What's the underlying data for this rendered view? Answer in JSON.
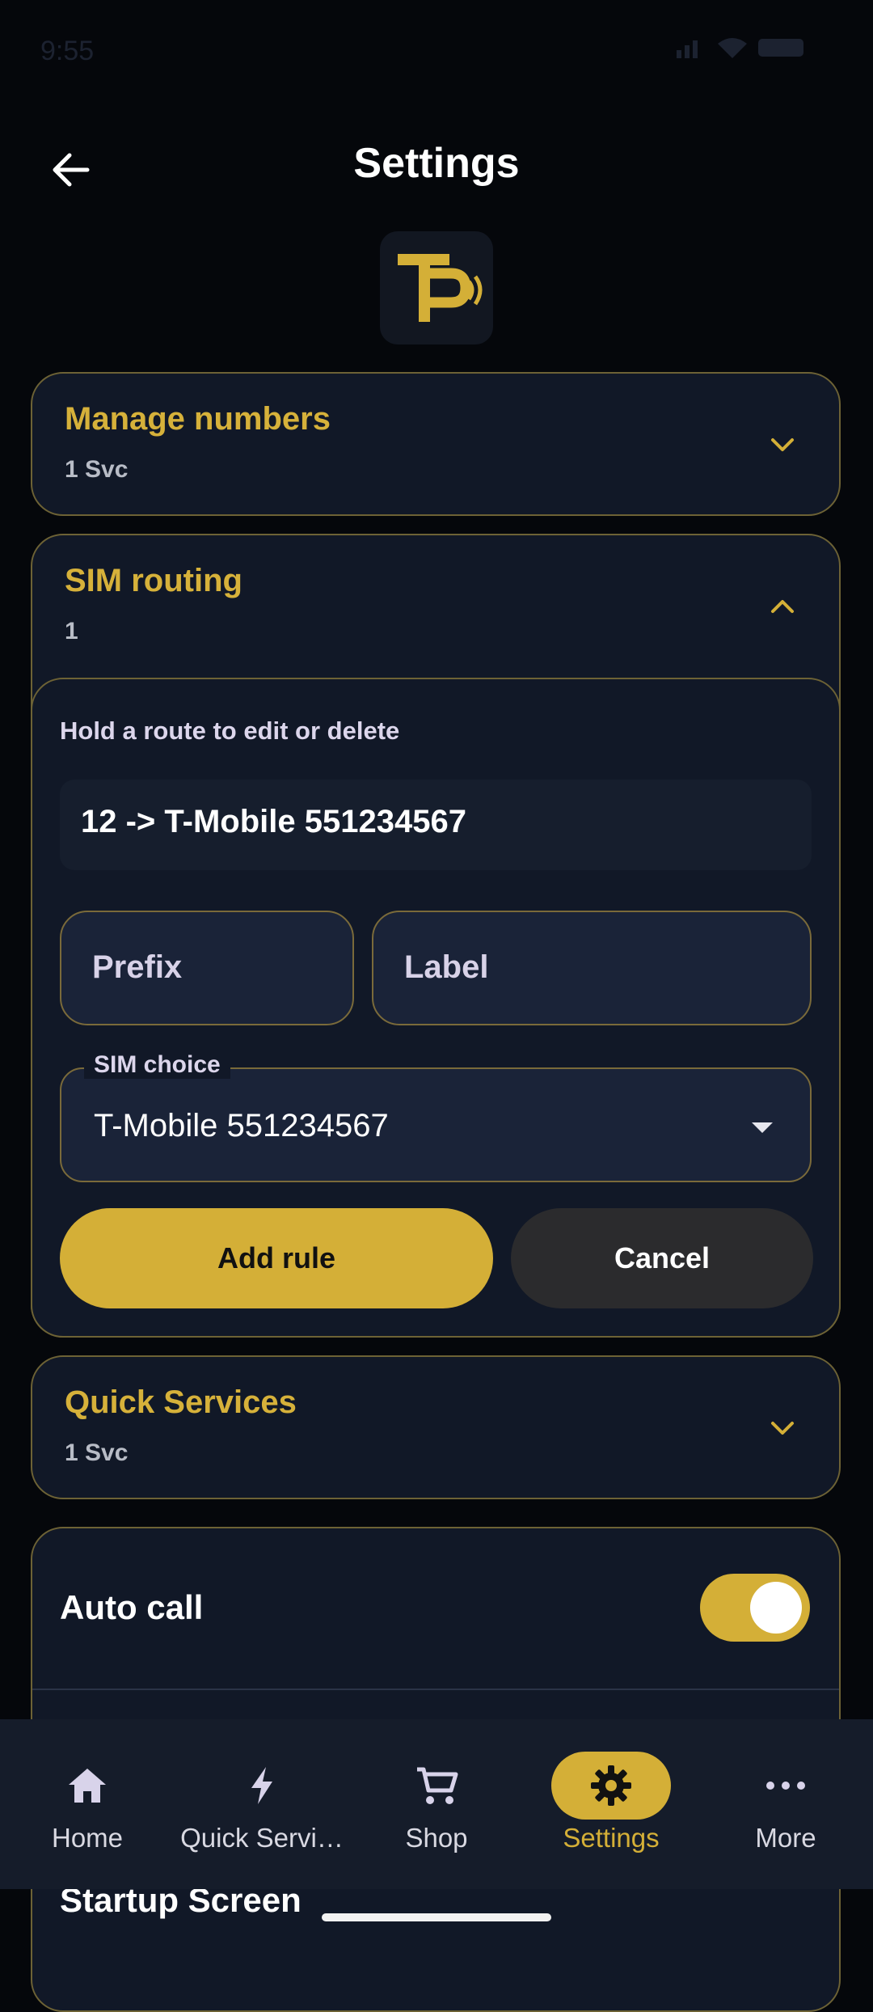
{
  "status_bar": {
    "time": "9:55"
  },
  "header": {
    "title": "Settings"
  },
  "colors": {
    "accent": "#d4af37",
    "card_bg": "#111827",
    "border": "#6d6235",
    "nav_bg": "#151c2a"
  },
  "sections": {
    "manage_numbers": {
      "title": "Manage numbers",
      "subtitle": "1 Svc"
    },
    "sim_routing": {
      "title": "SIM routing",
      "subtitle": "1",
      "hint": "Hold a route to edit or delete",
      "routes": [
        "12 -> T-Mobile 551234567"
      ],
      "prefix_placeholder": "Prefix",
      "label_placeholder": "Label",
      "sim_choice_label": "SIM choice",
      "sim_choice_value": "T-Mobile 551234567",
      "add_button": "Add rule",
      "cancel_button": "Cancel"
    },
    "quick_services": {
      "title": "Quick Services",
      "subtitle": "1 Svc"
    },
    "auto_call": {
      "label": "Auto call",
      "enabled": true
    },
    "startup_screen": {
      "label": "Startup Screen"
    }
  },
  "bottom_nav": {
    "items": [
      {
        "label": "Home",
        "icon": "home-icon"
      },
      {
        "label": "Quick Servi…",
        "icon": "bolt-icon"
      },
      {
        "label": "Shop",
        "icon": "cart-icon"
      },
      {
        "label": "Settings",
        "icon": "gear-icon",
        "active": true
      },
      {
        "label": "More",
        "icon": "more-icon"
      }
    ]
  }
}
